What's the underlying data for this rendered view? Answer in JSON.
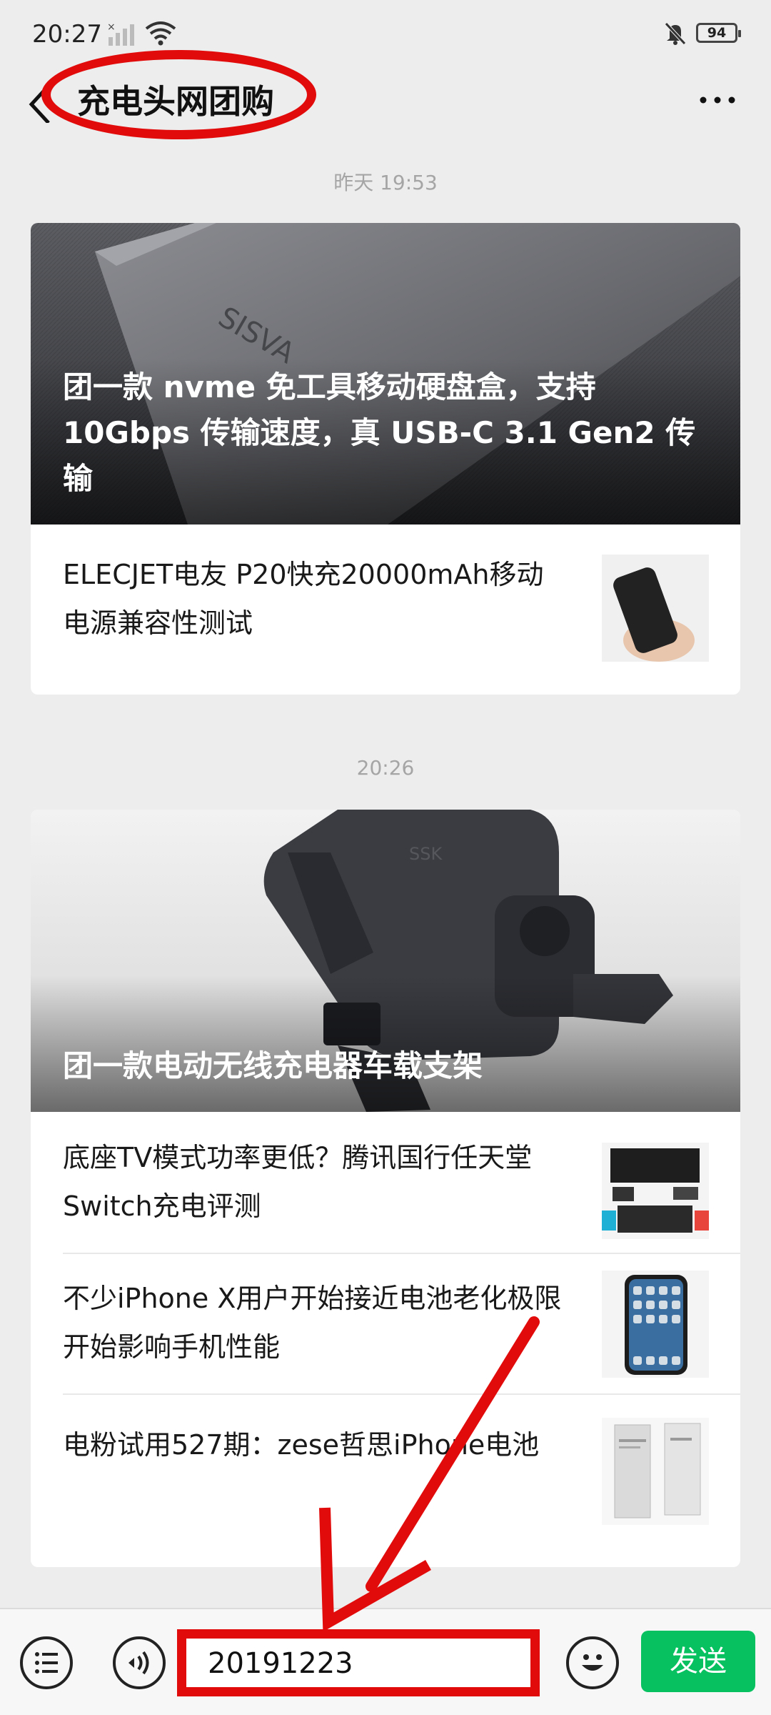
{
  "status": {
    "time": "20:27",
    "battery": "94"
  },
  "header": {
    "title": "充电头网团购"
  },
  "feed": [
    {
      "timestamp": "昨天 19:53",
      "hero": {
        "caption": "团一款 nvme 免工具移动硬盘盒，支持 10Gbps 传输速度，真 USB-C 3.1 Gen2 传输"
      },
      "items": [
        {
          "title": "ELECJET电友 P20快充20000mAh移动电源兼容性测试"
        }
      ]
    },
    {
      "timestamp": "20:26",
      "hero": {
        "caption": "团一款电动无线充电器车载支架"
      },
      "items": [
        {
          "title": "底座TV模式功率更低？腾讯国行任天堂Switch充电评测"
        },
        {
          "title": "不少iPhone X用户开始接近电池老化极限 开始影响手机性能"
        },
        {
          "title": "电粉试用527期：zese哲思iPhone电池"
        }
      ]
    }
  ],
  "input": {
    "value": "20191223"
  },
  "send_label": "发送",
  "colors": {
    "annotation_red": "#e20b0b",
    "send_green": "#07c160",
    "background": "#ededed"
  }
}
